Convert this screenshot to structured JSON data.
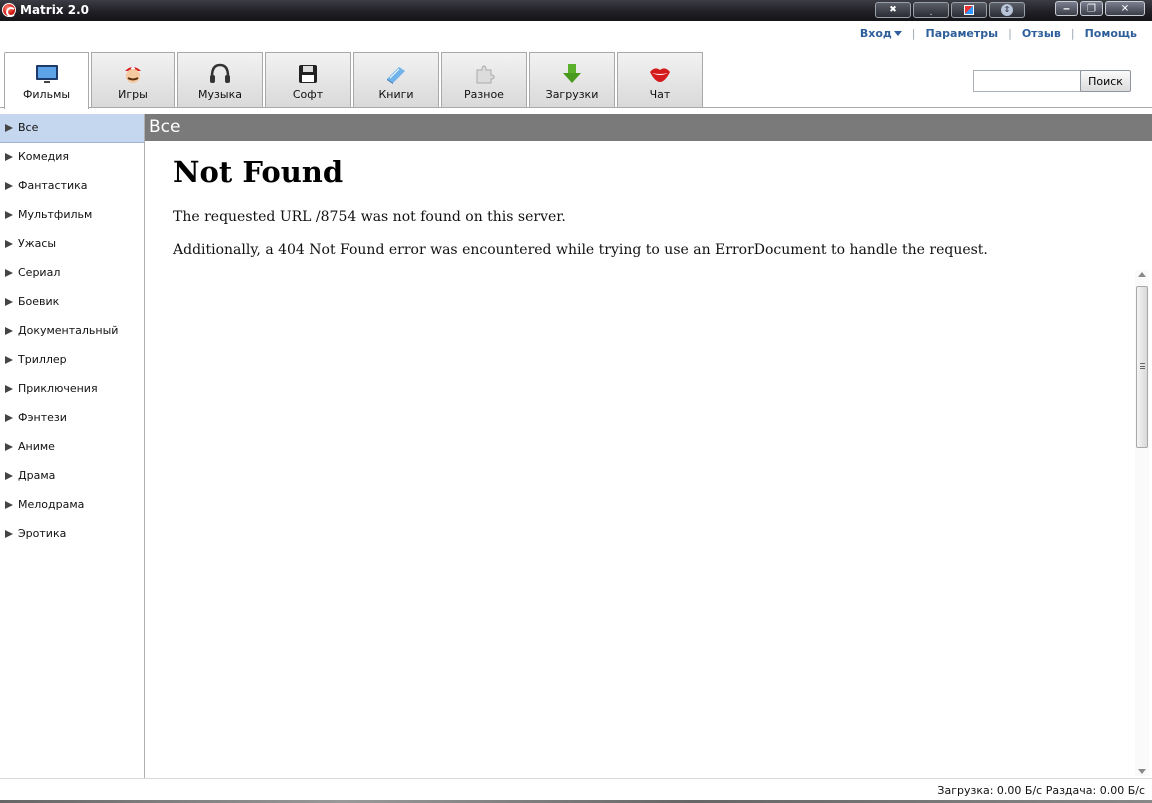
{
  "window": {
    "title": "Matrix 2.0"
  },
  "top_links": {
    "login": "Вход",
    "settings": "Параметры",
    "feedback": "Отзыв",
    "help": "Помощь"
  },
  "tabs": [
    {
      "label": "Фильмы",
      "icon": "tv-icon",
      "active": true
    },
    {
      "label": "Игры",
      "icon": "mario-icon"
    },
    {
      "label": "Музыка",
      "icon": "headphones-icon"
    },
    {
      "label": "Софт",
      "icon": "floppy-disk-icon"
    },
    {
      "label": "Книги",
      "icon": "book-icon"
    },
    {
      "label": "Разное",
      "icon": "puzzle-icon"
    },
    {
      "label": "Загрузки",
      "icon": "download-arrow-icon"
    },
    {
      "label": "Чат",
      "icon": "lips-icon"
    }
  ],
  "search": {
    "value": "",
    "placeholder": "",
    "button": "Поиск"
  },
  "sidebar": {
    "items": [
      {
        "label": "Все",
        "active": true
      },
      {
        "label": "Комедия"
      },
      {
        "label": "Фантастика"
      },
      {
        "label": "Мультфильм"
      },
      {
        "label": "Ужасы"
      },
      {
        "label": "Сериал"
      },
      {
        "label": "Боевик"
      },
      {
        "label": "Документальный"
      },
      {
        "label": "Триллер"
      },
      {
        "label": "Приключения"
      },
      {
        "label": "Фэнтези"
      },
      {
        "label": "Аниме"
      },
      {
        "label": "Драма"
      },
      {
        "label": "Мелодрама"
      },
      {
        "label": "Эротика"
      }
    ]
  },
  "content": {
    "header": "Все",
    "error_title": "Not Found",
    "error_line1": "The requested URL /8754 was not found on this server.",
    "error_line2": "Additionally, a 404 Not Found error was encountered while trying to use an ErrorDocument to handle the request."
  },
  "status": {
    "text": "Загрузка: 0.00 Б/с Раздача: 0.00 Б/с"
  },
  "colors": {
    "titlebar": "#1e1e24",
    "link": "#2e5f9b",
    "active_item": "#c5d7ee",
    "content_header": "#7a7a7a"
  }
}
